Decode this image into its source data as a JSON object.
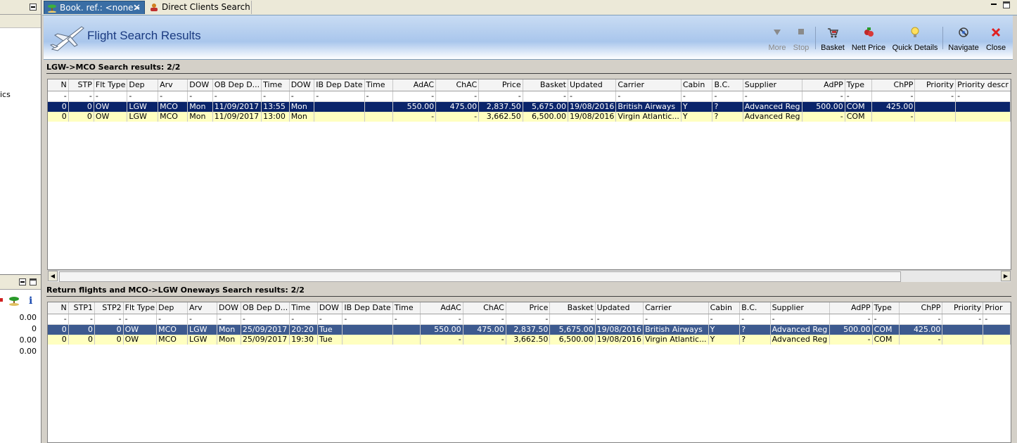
{
  "left_panel": {
    "fragment_text": "ics",
    "values": [
      "0.00",
      "0",
      "0.00",
      "0.00"
    ]
  },
  "tabs": [
    {
      "label": "Book. ref.: <none>"
    },
    {
      "label": "Direct Clients Search"
    }
  ],
  "header": {
    "title": "Flight Search Results",
    "buttons": {
      "more": "More",
      "stop": "Stop",
      "basket": "Basket",
      "nett_price": "Nett Price",
      "quick_details": "Quick Details",
      "navigate": "Navigate",
      "close": "Close"
    }
  },
  "outbound": {
    "title": "LGW->MCO Search results: 2/2",
    "columns": [
      "N",
      "STP",
      "Flt Type",
      "Dep",
      "Arv",
      "DOW",
      "OB Dep D...",
      "Time",
      "DOW",
      "IB Dep Date",
      "Time",
      "AdAC",
      "ChAC",
      "Price",
      "Basket",
      "Updated",
      "Carrier",
      "Cabin",
      "B.C.",
      "Supplier",
      "AdPP",
      "Type",
      "ChPP",
      "Priority",
      "Priority descr"
    ],
    "filter": [
      "-",
      "-",
      "-",
      "-",
      "-",
      "-",
      "-",
      "-",
      "-",
      "-",
      "-",
      "-",
      "-",
      "-",
      "-",
      "-",
      "-",
      "-",
      "-",
      "-",
      "-",
      "-",
      "-",
      "-",
      "-"
    ],
    "rows": [
      [
        "0",
        "0",
        "OW",
        "LGW",
        "MCO",
        "Mon",
        "11/09/2017",
        "13:55",
        "Mon",
        "",
        "",
        "550.00",
        "475.00",
        "2,837.50",
        "5,675.00",
        "19/08/2016",
        "British Airways",
        "Y",
        "?",
        "Advanced Reg",
        "500.00",
        "COM",
        "425.00",
        "",
        ""
      ],
      [
        "0",
        "0",
        "OW",
        "LGW",
        "MCO",
        "Mon",
        "11/09/2017",
        "13:00",
        "Mon",
        "",
        "",
        "-",
        "-",
        "3,662.50",
        "6,500.00",
        "19/08/2016",
        "Virgin Atlantic...",
        "Y",
        "?",
        "Advanced Reg",
        "-",
        "COM",
        "-",
        "",
        ""
      ]
    ]
  },
  "return": {
    "title": "Return flights and MCO->LGW Oneways Search results: 2/2",
    "columns": [
      "N",
      "STP1",
      "STP2",
      "Flt Type",
      "Dep",
      "Arv",
      "DOW",
      "OB Dep D...",
      "Time",
      "DOW",
      "IB Dep Date",
      "Time",
      "AdAC",
      "ChAC",
      "Price",
      "Basket",
      "Updated",
      "Carrier",
      "Cabin",
      "B.C.",
      "Supplier",
      "AdPP",
      "Type",
      "ChPP",
      "Priority",
      "Prior"
    ],
    "filter": [
      "-",
      "-",
      "-",
      "-",
      "-",
      "-",
      "-",
      "-",
      "-",
      "-",
      "-",
      "-",
      "-",
      "-",
      "-",
      "-",
      "-",
      "-",
      "-",
      "-",
      "-",
      "-",
      "-",
      "-",
      "-",
      "-"
    ],
    "rows": [
      [
        "0",
        "0",
        "0",
        "OW",
        "MCO",
        "LGW",
        "Mon",
        "25/09/2017",
        "20:20",
        "Tue",
        "",
        "",
        "550.00",
        "475.00",
        "2,837.50",
        "5,675.00",
        "19/08/2016",
        "British Airways",
        "Y",
        "?",
        "Advanced Reg",
        "500.00",
        "COM",
        "425.00",
        "",
        ""
      ],
      [
        "0",
        "0",
        "0",
        "OW",
        "MCO",
        "LGW",
        "Mon",
        "25/09/2017",
        "19:30",
        "Tue",
        "",
        "",
        "-",
        "-",
        "3,662.50",
        "6,500.00",
        "19/08/2016",
        "Virgin Atlantic...",
        "Y",
        "?",
        "Advanced Reg",
        "-",
        "COM",
        "-",
        "",
        ""
      ]
    ]
  },
  "colors": {
    "selected_row": "#0a246a",
    "selected_row_inactive": "#3d5a8f",
    "alt_row": "#ffffc0",
    "title_text": "#1a3a80"
  }
}
